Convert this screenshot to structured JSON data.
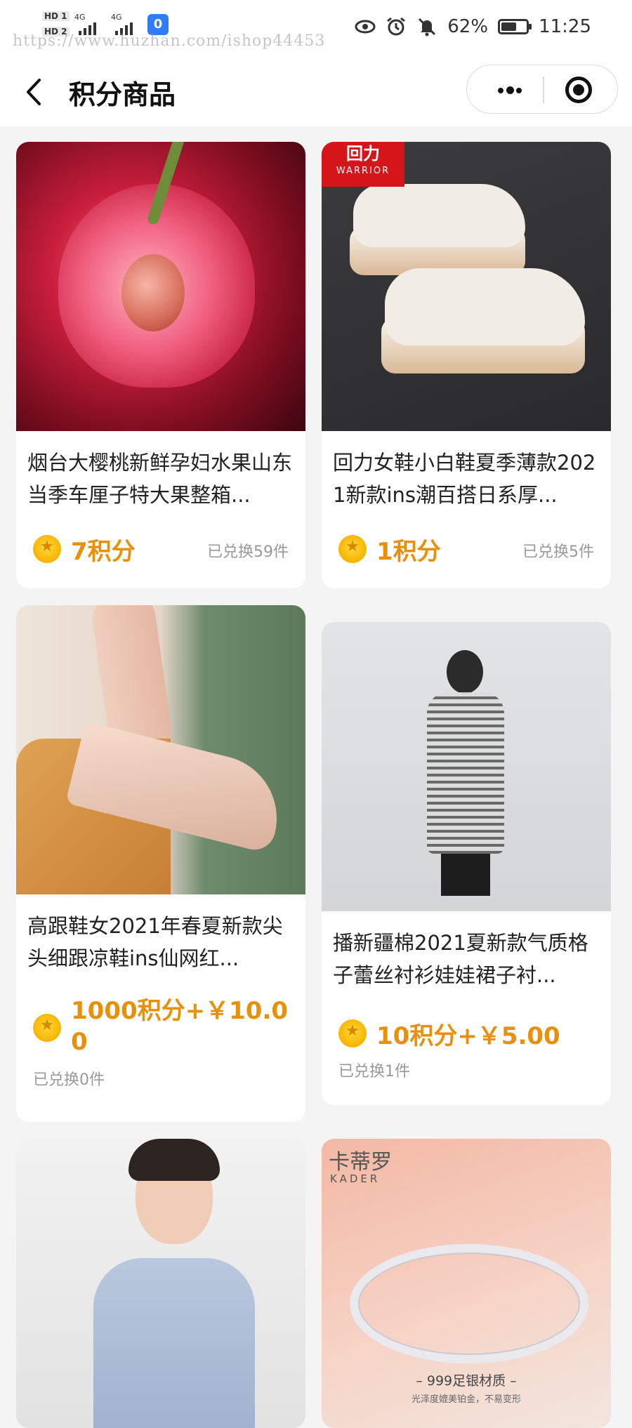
{
  "status_bar": {
    "hd1": "HD 1",
    "hd2": "HD 2",
    "net1": "4G",
    "net2": "4G",
    "app_badge": "0",
    "watermark": "https://www.huzhan.com/ishop44453",
    "battery": "62%",
    "battery_level": 0.62,
    "time": "11:25"
  },
  "nav": {
    "title": "积分商品"
  },
  "products": [
    {
      "name": "烟台大樱桃新鲜孕妇水果山东当季车厘子特大果整箱...",
      "price": "7积分",
      "sold": "已兑换59件"
    },
    {
      "name": "回力女鞋小白鞋夏季薄款2021新款ins潮百搭日系厚...",
      "price": "1积分",
      "sold": "已兑换5件",
      "brand_cn": "回力",
      "brand_en": "WARRIOR"
    },
    {
      "name": "高跟鞋女2021年春夏新款尖头细跟凉鞋ins仙网红...",
      "price": "1000积分+￥10.00",
      "sold": "已兑换0件"
    },
    {
      "name": "播新疆棉2021夏新款气质格子蕾丝衬衫娃娃裙子衬...",
      "price": "10积分+￥5.00",
      "sold": "已兑换1件"
    },
    {
      "name": "",
      "price": "",
      "sold": ""
    },
    {
      "name": "",
      "price": "",
      "sold": "",
      "brand_cn": "卡蒂罗",
      "brand_en": "KADER",
      "material": "– 999足银材质 –",
      "material_sub": "光泽度媲美铂金，不易变形"
    }
  ],
  "colors": {
    "accent": "#e8900a",
    "muted": "#999999",
    "background": "#f4f4f4"
  }
}
